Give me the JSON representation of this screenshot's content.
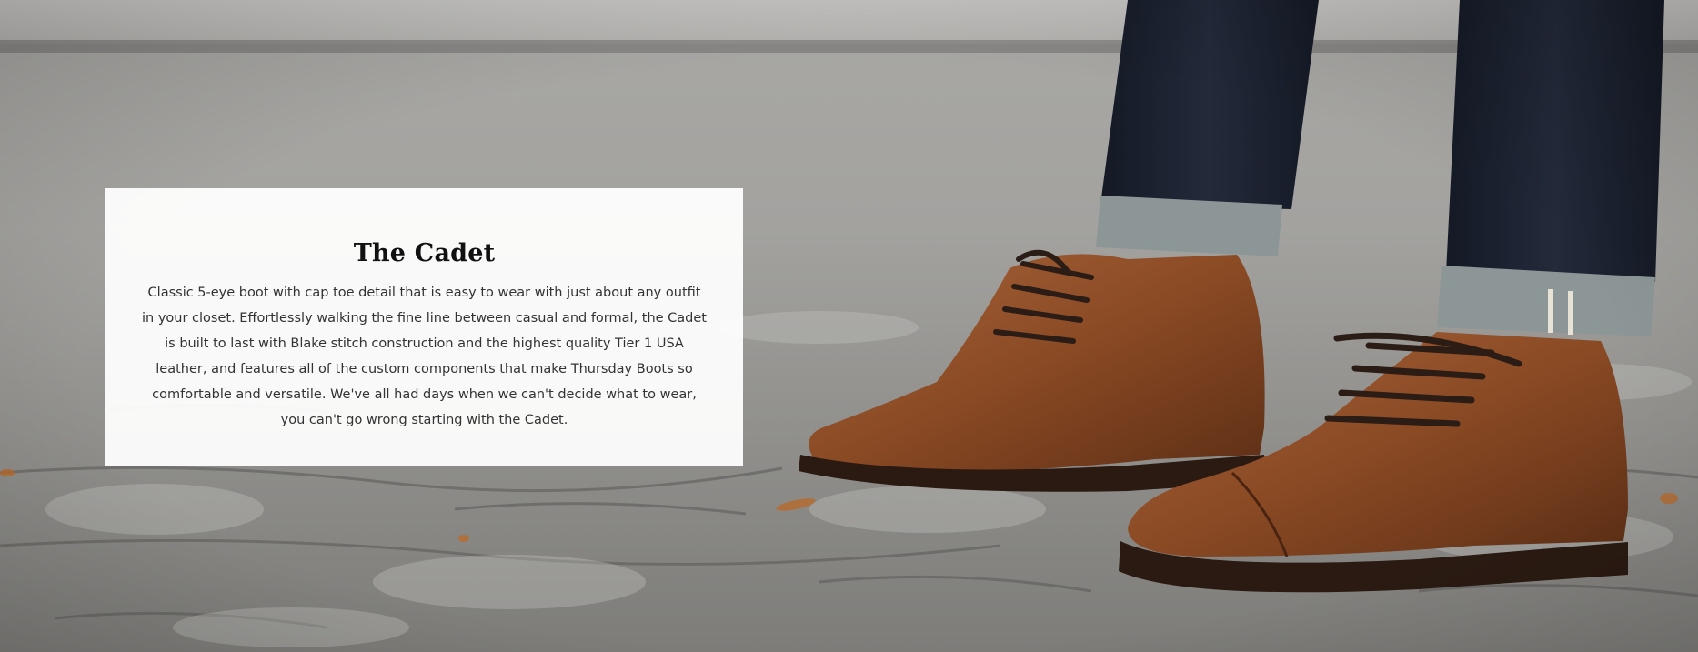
{
  "product": {
    "title": "The Cadet",
    "description": "Classic 5-eye boot with cap toe detail that is easy to wear with just about any outfit in your closet. Effortlessly walking the fine line between casual and formal, the Cadet is built to last with Blake stitch construction and the highest quality Tier 1 USA leather, and features all of the custom components that make Thursday Boots so comfortable and versatile. We've all had days when we can't decide what to wear, you can't go wrong starting with the Cadet."
  },
  "colors": {
    "card_background": "#ffffff",
    "title_text": "#111111",
    "body_text": "#333333",
    "boot_leather": "#8a4a24",
    "denim": "#1b2130",
    "cobblestone": "#9a9a98"
  }
}
